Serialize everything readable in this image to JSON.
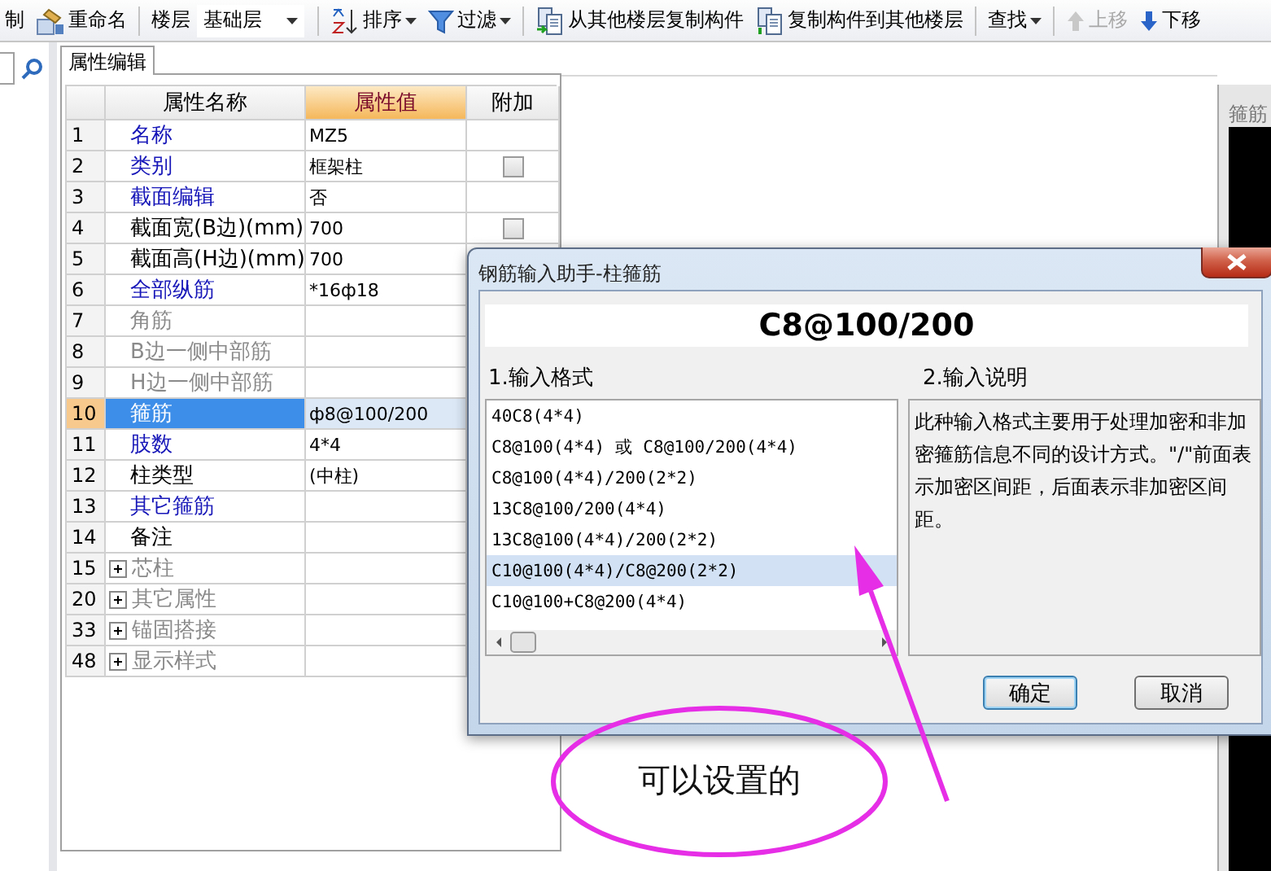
{
  "toolbar": [
    {
      "kind": "button",
      "label": "制",
      "disabled": false
    },
    {
      "kind": "button",
      "label": "重命名",
      "disabled": false
    },
    {
      "kind": "separator"
    },
    {
      "kind": "label",
      "label": "楼层"
    },
    {
      "kind": "select",
      "value": "基础层"
    },
    {
      "kind": "separator"
    },
    {
      "kind": "menu",
      "label": "排序",
      "disabled": false
    },
    {
      "kind": "menu",
      "label": "过滤",
      "disabled": false
    },
    {
      "kind": "separator"
    },
    {
      "kind": "button",
      "label": "从其他楼层复制构件",
      "disabled": false
    },
    {
      "kind": "button",
      "label": "复制构件到其他楼层",
      "disabled": false
    },
    {
      "kind": "separator"
    },
    {
      "kind": "menu",
      "label": "查找",
      "disabled": false
    },
    {
      "kind": "separator"
    },
    {
      "kind": "button",
      "label": "上移",
      "disabled": true
    },
    {
      "kind": "button",
      "label": "下移",
      "disabled": false
    }
  ],
  "property_panel": {
    "tabs": [
      {
        "label": "属性编辑",
        "selected": true
      }
    ],
    "columns": [
      "属性名称",
      "属性值",
      "附加"
    ],
    "rows": [
      {
        "number": "1",
        "name": "名称",
        "value": "MZ5",
        "kind": "public",
        "selected": false
      },
      {
        "number": "2",
        "name": "类别",
        "value": "框架柱",
        "kind": "public",
        "selected": false,
        "checked": false
      },
      {
        "number": "3",
        "name": "截面编辑",
        "value": "否",
        "kind": "public",
        "selected": false
      },
      {
        "number": "4",
        "name": "截面宽(B边)(mm)",
        "value": "700",
        "kind": "private",
        "selected": false,
        "checked": false
      },
      {
        "number": "5",
        "name": "截面高(H边)(mm)",
        "value": "700",
        "kind": "private",
        "selected": false
      },
      {
        "number": "6",
        "name": "全部纵筋",
        "value": "*16ф18",
        "kind": "public",
        "selected": false
      },
      {
        "number": "7",
        "name": "角筋",
        "kind": "inactive",
        "selected": false
      },
      {
        "number": "8",
        "name": "B边一侧中部筋",
        "kind": "inactive",
        "selected": false
      },
      {
        "number": "9",
        "name": "H边一侧中部筋",
        "kind": "inactive",
        "selected": false
      },
      {
        "number": "10",
        "name": "箍筋",
        "value": "ф8@100/200",
        "kind": "public",
        "selected": true
      },
      {
        "number": "11",
        "name": "肢数",
        "value": "4*4",
        "kind": "public",
        "selected": false
      },
      {
        "number": "12",
        "name": "柱类型",
        "value": "(中柱)",
        "kind": "private",
        "selected": false
      },
      {
        "number": "13",
        "name": "其它箍筋",
        "kind": "public",
        "selected": false
      },
      {
        "number": "14",
        "name": "备注",
        "kind": "private",
        "selected": false
      },
      {
        "number": "15",
        "name": "芯柱",
        "kind": "group",
        "selected": false,
        "expanded": false
      },
      {
        "number": "20",
        "name": "其它属性",
        "kind": "group",
        "selected": false,
        "expanded": false
      },
      {
        "number": "33",
        "name": "锚固搭接",
        "kind": "group",
        "selected": false,
        "expanded": false
      },
      {
        "number": "48",
        "name": "显示样式",
        "kind": "group",
        "selected": false,
        "expanded": false
      }
    ]
  },
  "side_panel": {
    "title": "箍筋"
  },
  "dialog": {
    "title": "钢筋输入助手-柱箍筋",
    "formula": "C8@100/200",
    "format_label": "1.输入格式",
    "description_label": "2.输入说明",
    "formats": [
      {
        "text": "40C8(4*4)",
        "selected": false
      },
      {
        "text": "C8@100(4*4) 或 C8@100/200(4*4)",
        "selected": false
      },
      {
        "text": "C8@100(4*4)/200(2*2)",
        "selected": false
      },
      {
        "text": "13C8@100/200(4*4)",
        "selected": false
      },
      {
        "text": "13C8@100(4*4)/200(2*2)",
        "selected": false
      },
      {
        "text": "C10@100(4*4)/C8@200(2*2)",
        "selected": true
      },
      {
        "text": "C10@100+C8@200(4*4)",
        "selected": false
      }
    ],
    "description": "此种输入格式主要用于处理加密和非加密箍筋信息不同的设计方式。\"/\"前面表示加密区间距，后面表示非加密区间距。",
    "buttons": [
      {
        "label": "确定",
        "default": true
      },
      {
        "label": "取消",
        "default": false
      }
    ]
  },
  "annotation": {
    "text": "可以设置的"
  }
}
